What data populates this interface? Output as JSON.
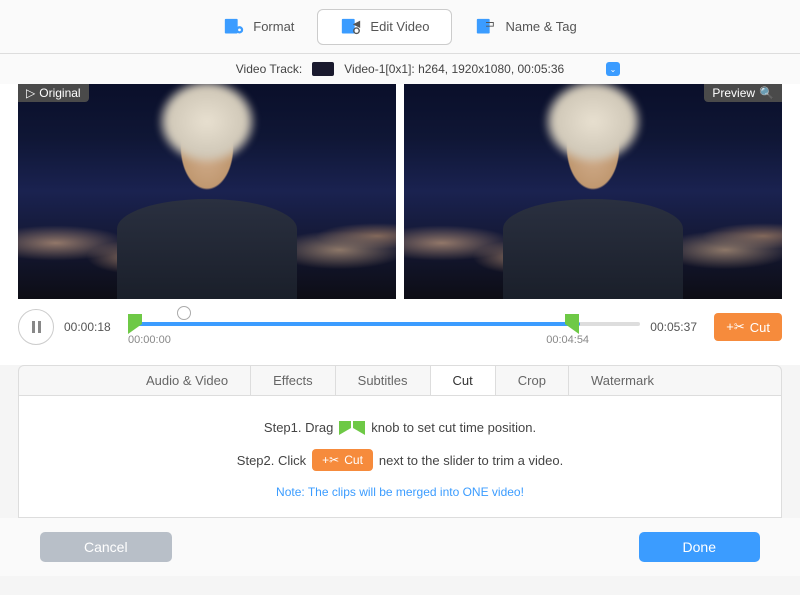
{
  "topTabs": {
    "format": "Format",
    "editVideo": "Edit Video",
    "nameTag": "Name & Tag"
  },
  "trackRow": {
    "label": "Video Track:",
    "value": "Video-1[0x1]: h264, 1920x1080, 00:05:36"
  },
  "panes": {
    "original": "Original",
    "preview": "Preview"
  },
  "timeline": {
    "current": "00:00:18",
    "total": "00:05:37",
    "start": "00:00:00",
    "end": "00:04:54",
    "cutLabel": "Cut"
  },
  "editTabs": {
    "audioVideo": "Audio & Video",
    "effects": "Effects",
    "subtitles": "Subtitles",
    "cut": "Cut",
    "crop": "Crop",
    "watermark": "Watermark"
  },
  "instructions": {
    "step1a": "Step1. Drag",
    "step1b": "knob to set cut time position.",
    "step2a": "Step2. Click",
    "step2b": "next to the slider to trim a video.",
    "cutLabel": "Cut",
    "note": "Note: The clips will be merged into ONE video!"
  },
  "footer": {
    "cancel": "Cancel",
    "done": "Done"
  }
}
